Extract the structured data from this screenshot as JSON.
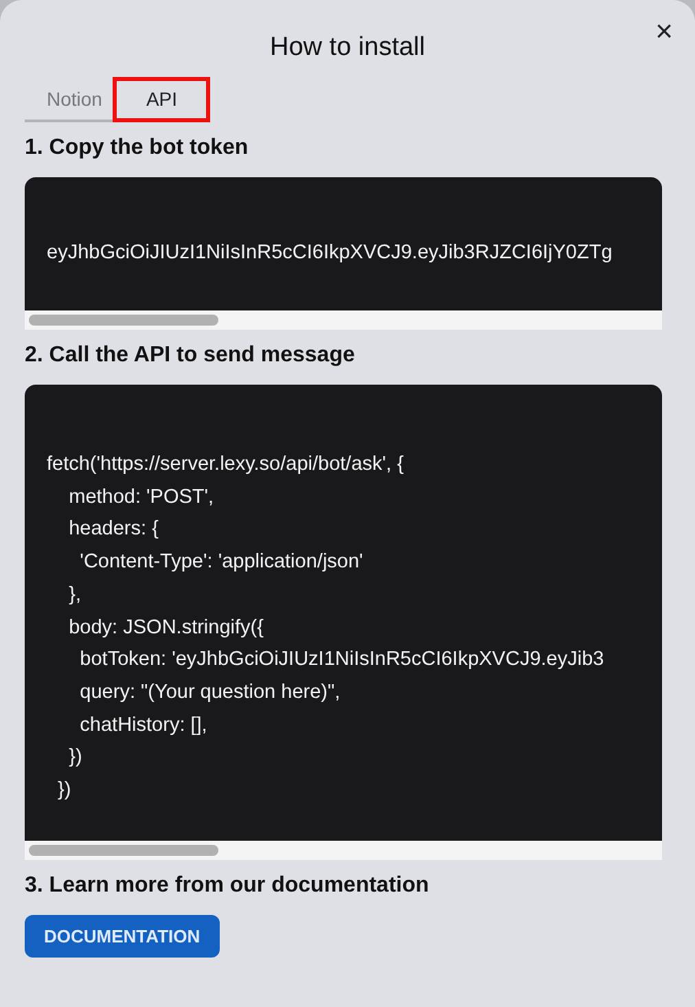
{
  "dialog": {
    "title": "How to install",
    "close_label": "×"
  },
  "tabs": [
    {
      "label": "Notion",
      "selected": false,
      "highlighted": false
    },
    {
      "label": "API",
      "selected": true,
      "highlighted": true
    }
  ],
  "steps": [
    {
      "heading": "1. Copy the bot token",
      "kind": "code",
      "lines": [
        "eyJhbGciOiJIUzI1NiIsInR5cCI6IkpXVCJ9.eyJib3RJZCI6IjY0ZTg"
      ]
    },
    {
      "heading": "2. Call the API to send message",
      "kind": "code",
      "lines": [
        "fetch('https://server.lexy.so/api/bot/ask', {",
        "    method: 'POST',",
        "    headers: {",
        "      'Content-Type': 'application/json'",
        "    },",
        "    body: JSON.stringify({",
        "      botToken: 'eyJhbGciOiJIUzI1NiIsInR5cCI6IkpXVCJ9.eyJib3",
        "      query: \"(Your question here)\",",
        "      chatHistory: [],",
        "    })",
        "  })"
      ]
    },
    {
      "heading": "3. Learn more from our documentation",
      "kind": "button",
      "button": "DOCUMENTATION"
    }
  ]
}
